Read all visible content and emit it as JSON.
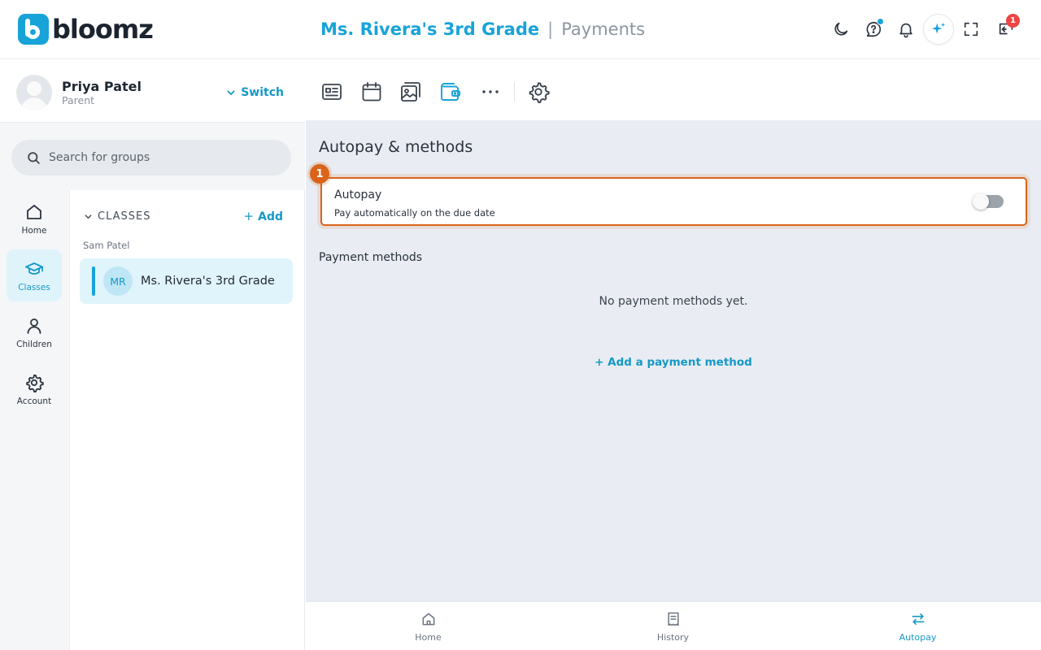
{
  "brand": {
    "name": "bloomz"
  },
  "header": {
    "class_name": "Ms. Rivera's 3rd Grade",
    "separator": "|",
    "page": "Payments",
    "inbox_badge": "1"
  },
  "profile": {
    "name": "Priya Patel",
    "role": "Parent",
    "switch_label": "Switch"
  },
  "search": {
    "placeholder": "Search for groups"
  },
  "rail": {
    "items": [
      {
        "label": "Home",
        "icon": "home-icon"
      },
      {
        "label": "Classes",
        "icon": "graduation-cap-icon"
      },
      {
        "label": "Children",
        "icon": "person-icon"
      },
      {
        "label": "Account",
        "icon": "gear-icon"
      }
    ],
    "active": "Classes"
  },
  "groups": {
    "section_label": "CLASSES",
    "add_label": "Add",
    "child_name": "Sam Patel",
    "classes": [
      {
        "initials": "MR",
        "name": "Ms. Rivera's 3rd Grade"
      }
    ]
  },
  "toolbar": {
    "tools": [
      "news-icon",
      "calendar-icon",
      "photos-icon",
      "wallet-icon",
      "more-icon",
      "settings-icon"
    ],
    "active": "wallet-icon"
  },
  "payments": {
    "section_title": "Autopay & methods",
    "step_badge": "1",
    "autopay": {
      "title": "Autopay",
      "description": "Pay automatically on the due date",
      "enabled": false
    },
    "methods_title": "Payment methods",
    "empty_message": "No payment methods yet.",
    "add_method_label": "+ Add a payment method"
  },
  "bottom_nav": {
    "items": [
      {
        "label": "Home",
        "icon": "home-icon"
      },
      {
        "label": "History",
        "icon": "receipt-icon"
      },
      {
        "label": "Autopay",
        "icon": "swap-arrows-icon"
      }
    ],
    "active": "Autopay"
  },
  "colors": {
    "accent": "#18a3d8",
    "highlight": "#d9641a",
    "badge_red": "#ef4444"
  }
}
